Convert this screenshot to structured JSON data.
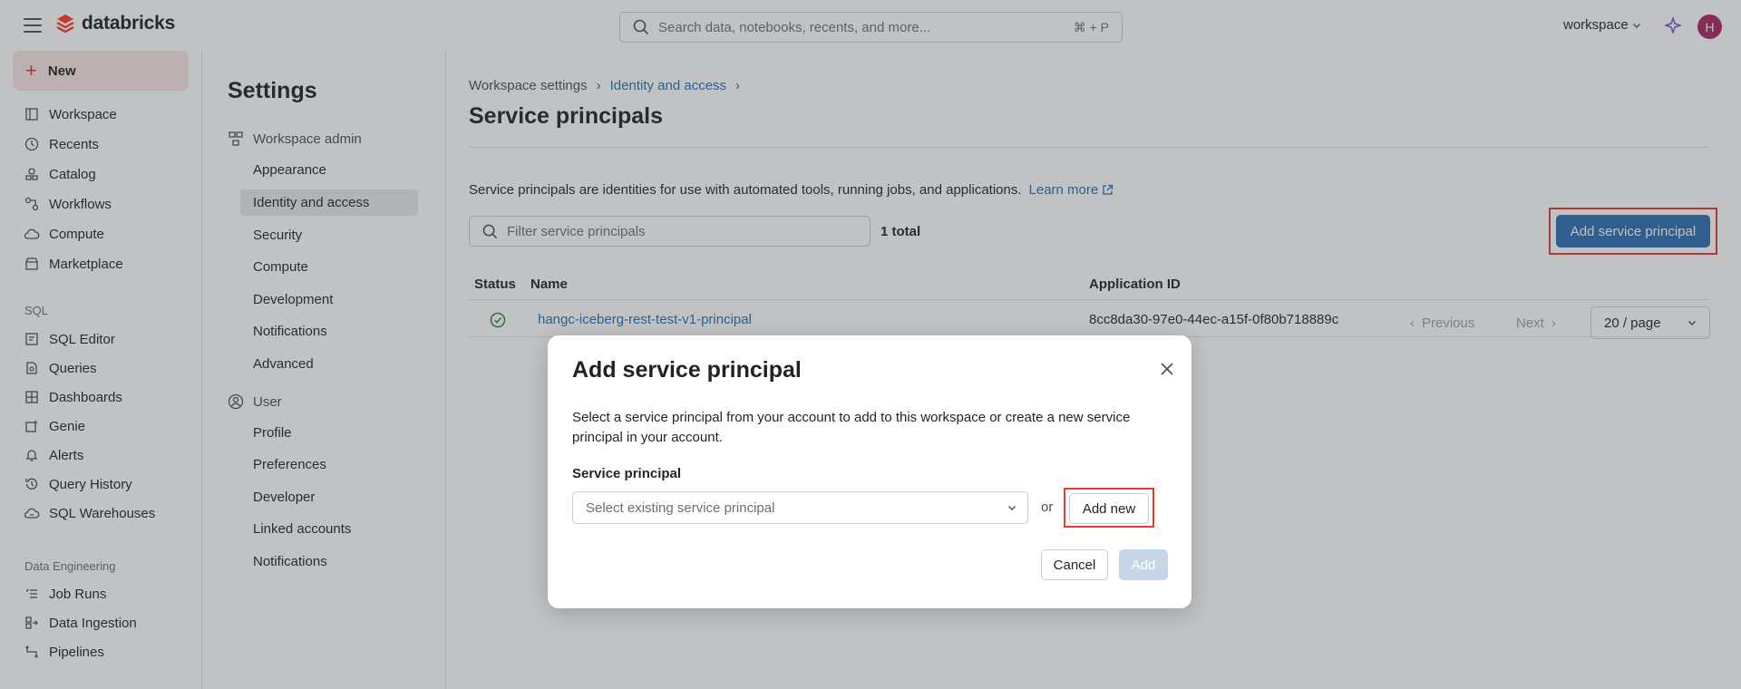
{
  "brand": {
    "name": "databricks",
    "accent": "#ff3621"
  },
  "topbar": {
    "search_placeholder": "Search data, notebooks, recents, and more...",
    "search_shortcut": "⌘ + P",
    "workspace_label": "workspace",
    "avatar_initial": "H"
  },
  "leftnav": {
    "new_label": "New",
    "items_top": [
      "Workspace",
      "Recents",
      "Catalog",
      "Workflows",
      "Compute",
      "Marketplace"
    ],
    "sql_section": "SQL",
    "items_sql": [
      "SQL Editor",
      "Queries",
      "Dashboards",
      "Genie",
      "Alerts",
      "Query History",
      "SQL Warehouses"
    ],
    "de_section": "Data Engineering",
    "items_de": [
      "Job Runs",
      "Data Ingestion",
      "Pipelines"
    ]
  },
  "settings": {
    "title": "Settings",
    "admin_group": "Workspace admin",
    "admin_items": [
      "Appearance",
      "Identity and access",
      "Security",
      "Compute",
      "Development",
      "Notifications",
      "Advanced"
    ],
    "active_item": "Identity and access",
    "user_group": "User",
    "user_items": [
      "Profile",
      "Preferences",
      "Developer",
      "Linked accounts",
      "Notifications"
    ]
  },
  "main": {
    "breadcrumb": [
      "Workspace settings",
      "Identity and access"
    ],
    "title": "Service principals",
    "description": "Service principals are identities for use with automated tools, running jobs, and applications.",
    "learn_more": "Learn more",
    "filter_placeholder": "Filter service principals",
    "total": "1 total",
    "add_button": "Add service principal",
    "table": {
      "headers": [
        "Status",
        "Name",
        "Application ID"
      ],
      "rows": [
        {
          "name": "hangc-iceberg-rest-test-v1-principal",
          "app_id": "8cc8da30-97e0-44ec-a15f-0f80b718889c",
          "status": "active"
        }
      ]
    },
    "pager": {
      "previous": "Previous",
      "next": "Next",
      "page_size": "20 / page"
    }
  },
  "modal": {
    "title": "Add service principal",
    "description": "Select a service principal from your account to add to this workspace or create a new service principal in your account.",
    "field_label": "Service principal",
    "select_placeholder": "Select existing service principal",
    "or_text": "or",
    "add_new": "Add new",
    "cancel": "Cancel",
    "add": "Add"
  }
}
